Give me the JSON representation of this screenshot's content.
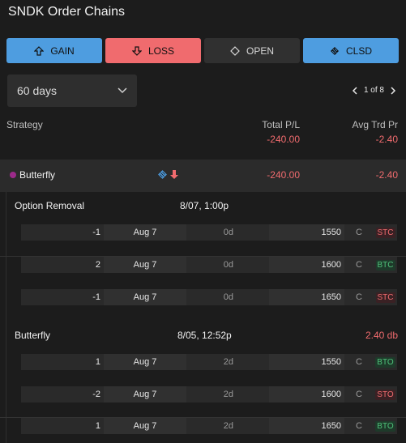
{
  "title": "SNDK Order Chains",
  "filters": [
    {
      "label": "GAIN"
    },
    {
      "label": "LOSS"
    },
    {
      "label": "OPEN"
    },
    {
      "label": "CLSD"
    }
  ],
  "period": {
    "selected": "60 days"
  },
  "pager": {
    "text": "1 of 8"
  },
  "columns": {
    "strategy": "Strategy",
    "total": "Total P/L",
    "avg": "Avg Trd Pr"
  },
  "summary": {
    "total": "-240.00",
    "avg": "-2.40"
  },
  "group": {
    "name": "Butterfly",
    "total": "-240.00",
    "avg": "-2.40"
  },
  "orders": [
    {
      "label": "Option Removal",
      "date": "8/07, 1:00p",
      "extra": "",
      "legs": [
        {
          "qty": "-1",
          "date": "Aug 7",
          "dte": "0d",
          "strike": "1550",
          "type": "C",
          "action": "STC"
        },
        {
          "qty": "2",
          "date": "Aug 7",
          "dte": "0d",
          "strike": "1600",
          "type": "C",
          "action": "BTC"
        },
        {
          "qty": "-1",
          "date": "Aug 7",
          "dte": "0d",
          "strike": "1650",
          "type": "C",
          "action": "STC"
        }
      ]
    },
    {
      "label": "Butterfly",
      "date": "8/05, 12:52p",
      "extra": "2.40 db",
      "legs": [
        {
          "qty": "1",
          "date": "Aug 7",
          "dte": "2d",
          "strike": "1550",
          "type": "C",
          "action": "BTO"
        },
        {
          "qty": "-2",
          "date": "Aug 7",
          "dte": "2d",
          "strike": "1600",
          "type": "C",
          "action": "STO"
        },
        {
          "qty": "1",
          "date": "Aug 7",
          "dte": "2d",
          "strike": "1650",
          "type": "C",
          "action": "BTO"
        }
      ]
    }
  ]
}
